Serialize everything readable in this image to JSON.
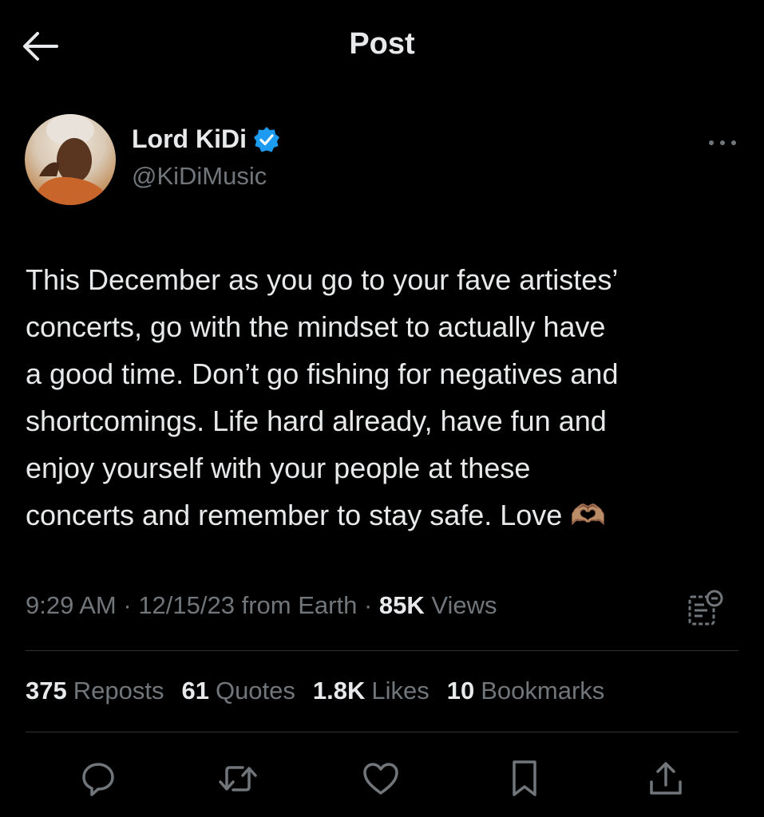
{
  "header": {
    "title": "Post"
  },
  "author": {
    "name": "Lord KiDi",
    "handle": "@KiDiMusic"
  },
  "post": {
    "lines": [
      "This December as you go to your fave artistes’",
      "concerts, go with the mindset to actually have",
      "a good time. Don’t go fishing for negatives and",
      "shortcomings. Life hard already, have fun and",
      "enjoy yourself with your people at these",
      "concerts and remember to stay safe. Love"
    ],
    "emoji": "🫶🏽"
  },
  "meta": {
    "time": "9:29 AM",
    "date": "12/15/23",
    "source": "from Earth",
    "views_count": "85K",
    "views_label": "Views"
  },
  "stats": {
    "reposts_count": "375",
    "reposts_label": "Reposts",
    "quotes_count": "61",
    "quotes_label": "Quotes",
    "likes_count": "1.8K",
    "likes_label": "Likes",
    "bookmarks_count": "10",
    "bookmarks_label": "Bookmarks"
  },
  "icons": {
    "back": "arrow-left-icon",
    "verified": "verified-badge-icon",
    "more": "more-horizontal-icon",
    "analytics": "post-analytics-icon",
    "reply": "reply-icon",
    "repost": "repost-icon",
    "like": "heart-icon",
    "bookmark": "bookmark-icon",
    "share": "share-icon"
  },
  "colors": {
    "background": "#000000",
    "text": "#e7e9ea",
    "secondary": "#71767b",
    "verified": "#1d9bf0",
    "divider": "#2f3336"
  }
}
